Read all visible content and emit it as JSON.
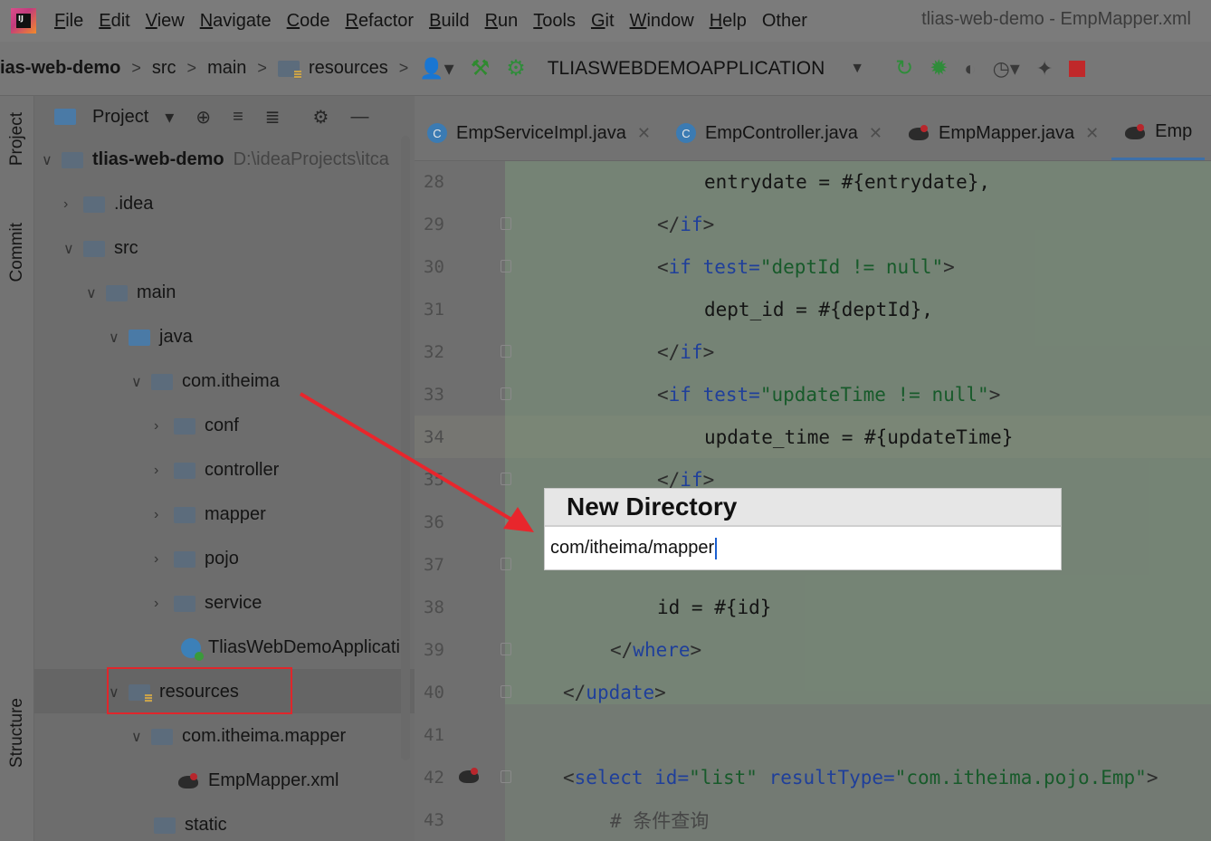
{
  "menubar": {
    "items": [
      {
        "label": "File",
        "mnemonic": "F",
        "rest": "ile"
      },
      {
        "label": "Edit",
        "mnemonic": "E",
        "rest": "dit"
      },
      {
        "label": "View",
        "mnemonic": "V",
        "rest": "iew"
      },
      {
        "label": "Navigate",
        "mnemonic": "N",
        "rest": "avigate"
      },
      {
        "label": "Code",
        "mnemonic": "C",
        "rest": "ode"
      },
      {
        "label": "Refactor",
        "mnemonic": "R",
        "rest": "efactor"
      },
      {
        "label": "Build",
        "mnemonic": "B",
        "rest": "uild"
      },
      {
        "label": "Run",
        "mnemonic": "R",
        "rest": "un",
        "prefix": "",
        "underline_index": 1
      },
      {
        "label": "Tools",
        "mnemonic": "T",
        "rest": "ools"
      },
      {
        "label": "Git",
        "mnemonic": "G",
        "rest": "it"
      },
      {
        "label": "Window",
        "mnemonic": "W",
        "rest": "indow"
      },
      {
        "label": "Help",
        "mnemonic": "H",
        "rest": "elp"
      },
      {
        "label": "Other",
        "mnemonic": "",
        "rest": "Other"
      }
    ],
    "window_title": "tlias-web-demo - EmpMapper.xml"
  },
  "navbar": {
    "crumbs": [
      "ias-web-demo",
      "src",
      "main",
      "resources"
    ],
    "run_config": "TLIASWEBDEMOAPPLICATION"
  },
  "tool_stripe": {
    "project_tab": "Project",
    "commit_tab": "Commit",
    "structure_tab": "Structure"
  },
  "project_panel": {
    "title": "Project",
    "root_name": "tlias-web-demo",
    "root_path": "D:\\ideaProjects\\itca",
    "tree": [
      {
        "label": ".idea"
      },
      {
        "label": "src"
      },
      {
        "label": "main"
      },
      {
        "label": "java"
      },
      {
        "label": "com.itheima"
      },
      {
        "label": "conf"
      },
      {
        "label": "controller"
      },
      {
        "label": "mapper"
      },
      {
        "label": "pojo"
      },
      {
        "label": "service"
      },
      {
        "label": "TliasWebDemoApplicati"
      },
      {
        "label": "resources"
      },
      {
        "label": "com.itheima.mapper"
      },
      {
        "label": "EmpMapper.xml"
      },
      {
        "label": "static"
      }
    ]
  },
  "tabs": [
    {
      "label": "EmpServiceImpl.java",
      "icon": "C"
    },
    {
      "label": "EmpController.java",
      "icon": "C"
    },
    {
      "label": "EmpMapper.java"
    },
    {
      "label": "Emp"
    }
  ],
  "editor": {
    "line_numbers": [
      "28",
      "29",
      "30",
      "31",
      "32",
      "33",
      "34",
      "35",
      "36",
      "37",
      "38",
      "39",
      "40",
      "41",
      "42",
      "43"
    ],
    "lines": {
      "l28": {
        "text": "entrydate = #{entrydate},"
      },
      "l29": {
        "open": "</",
        "kw": "if",
        "close": ">"
      },
      "l30": {
        "open": "<",
        "kw": "if",
        "attr": " test=",
        "str": "\"deptId != null\"",
        "close": ">"
      },
      "l31": {
        "text": "dept_id = #{deptId},"
      },
      "l32": {
        "open": "</",
        "kw": "if",
        "close": ">"
      },
      "l33": {
        "open": "<",
        "kw": "if",
        "attr": " test=",
        "str": "\"updateTime != null\"",
        "close": ">"
      },
      "l34": {
        "text": "update_time = #{updateTime}"
      },
      "l35": {
        "open": "</",
        "kw": "if",
        "close": ">"
      },
      "l38": {
        "text": "id = #{id}"
      },
      "l39": {
        "open": "</",
        "kw": "where",
        "close": ">"
      },
      "l40": {
        "open": "</",
        "kw": "update",
        "close": ">"
      },
      "l42": {
        "open": "<",
        "kw": "select",
        "attr1": " id=",
        "str1": "\"list\"",
        "attr2": " resultType=",
        "str2": "\"com.itheima.pojo.Emp\"",
        "close": ">"
      },
      "l43": {
        "text": "# 条件查询"
      }
    }
  },
  "dialog": {
    "title": "New Directory",
    "input_value": "com/itheima/mapper"
  },
  "colors": {
    "annotation_arrow": "#e8262c",
    "highlight_box": "#e0262b",
    "active_tab_underline": "#3d6fa8"
  }
}
